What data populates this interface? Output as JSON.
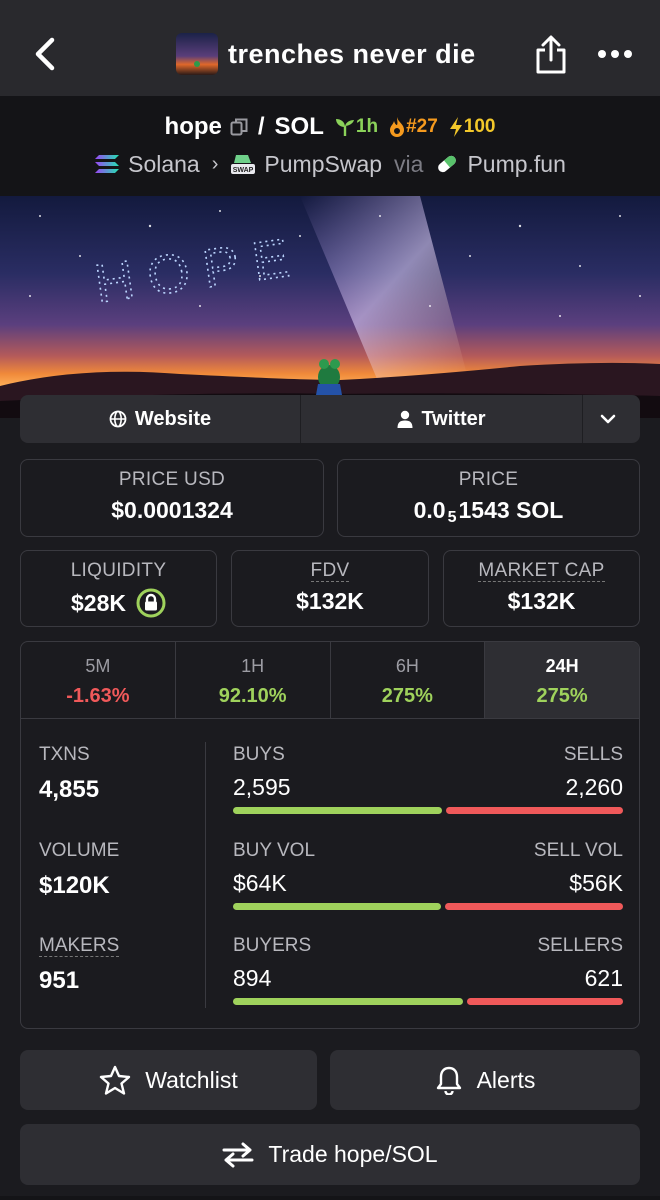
{
  "header": {
    "title": "trenches never die"
  },
  "pair": {
    "base": "hope",
    "slash": "/",
    "quote": "SOL",
    "age_badge": "1h",
    "rank_badge": "#27",
    "boost_badge": "100",
    "chain": "Solana",
    "dex": "PumpSwap",
    "via": "via",
    "launchpad": "Pump.fun",
    "chain_icon_label": "SWAP"
  },
  "banner": {
    "text": "HOPE"
  },
  "links": {
    "website": "Website",
    "twitter": "Twitter"
  },
  "stats": {
    "price_usd_label": "PRICE USD",
    "price_usd_value": "$0.0001324",
    "price_label": "PRICE",
    "price_value_prefix": "0.0",
    "price_value_sub": "5",
    "price_value_rest": "1543 SOL",
    "liquidity_label": "LIQUIDITY",
    "liquidity_value": "$28K",
    "fdv_label": "FDV",
    "fdv_value": "$132K",
    "mcap_label": "MARKET CAP",
    "mcap_value": "$132K"
  },
  "timeframes": [
    {
      "label": "5M",
      "change": "-1.63%"
    },
    {
      "label": "1H",
      "change": "92.10%"
    },
    {
      "label": "6H",
      "change": "275%"
    },
    {
      "label": "24H",
      "change": "275%"
    }
  ],
  "metrics": {
    "txns_label": "TXNS",
    "txns_value": "4,855",
    "volume_label": "VOLUME",
    "volume_value": "$120K",
    "makers_label": "MAKERS",
    "makers_value": "951",
    "buys_label": "BUYS",
    "sells_label": "SELLS",
    "buys_value": "2,595",
    "sells_value": "2,260",
    "buys_fraction": 0.535,
    "buyvol_label": "BUY VOL",
    "sellvol_label": "SELL VOL",
    "buyvol_value": "$64K",
    "sellvol_value": "$56K",
    "buyvol_fraction": 0.533,
    "buyers_label": "BUYERS",
    "sellers_label": "SELLERS",
    "buyers_value": "894",
    "sellers_value": "621",
    "buyers_fraction": 0.59
  },
  "actions": {
    "watchlist": "Watchlist",
    "alerts": "Alerts",
    "trade": "Trade hope/SOL"
  },
  "colors": {
    "positive": "#9fd25c",
    "negative": "#f0595a",
    "rank": "#f59a1e",
    "boost": "#f3c82a"
  }
}
